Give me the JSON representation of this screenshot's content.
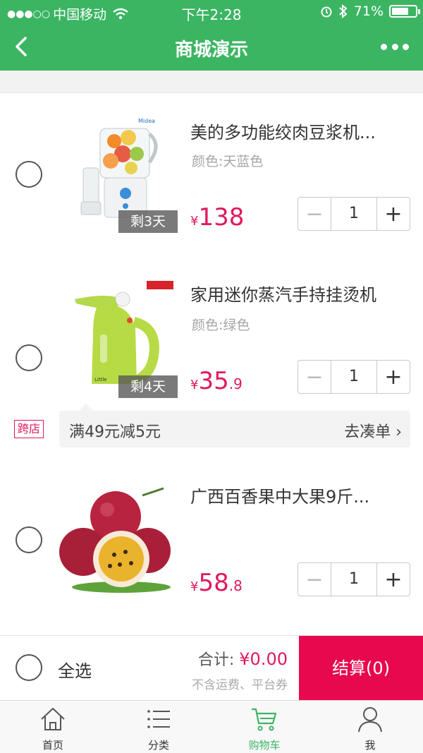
{
  "status_bar": {
    "carrier": "中国移动",
    "time": "下午2:28",
    "battery_percent": "71%",
    "battery_level": 0.71
  },
  "nav": {
    "title": "商城演示"
  },
  "items": [
    {
      "name": "美的多功能绞肉豆浆机...",
      "spec": "颜色:天蓝色",
      "remain": "剩3天",
      "currency": "¥",
      "price_int": "138",
      "price_dec": "",
      "qty": "1"
    },
    {
      "name": "家用迷你蒸汽手持挂烫机",
      "spec": "颜色:绿色",
      "remain": "剩4天",
      "currency": "¥",
      "price_int": "35",
      "price_dec": ".9",
      "qty": "1"
    },
    {
      "name": "广西百香果中大果9斤...",
      "spec": "",
      "remain": "",
      "currency": "¥",
      "price_int": "58",
      "price_dec": ".8",
      "qty": "1"
    }
  ],
  "promo": {
    "tag": "跨店",
    "text": "满49元减5元",
    "action": "去凑单"
  },
  "checkout": {
    "select_all": "全选",
    "total_label": "合计:",
    "total_amount": "¥0.00",
    "note": "不含运费、平台券",
    "pay_button": "结算(0)"
  },
  "tabs": [
    {
      "label": "首页",
      "icon": "home-icon"
    },
    {
      "label": "分类",
      "icon": "list-icon"
    },
    {
      "label": "购物车",
      "icon": "cart-icon",
      "active": true
    },
    {
      "label": "我",
      "icon": "user-icon"
    }
  ],
  "colors": {
    "brand_green": "#3cb563",
    "price_red": "#e0195a",
    "pay_red": "#e8084d"
  }
}
